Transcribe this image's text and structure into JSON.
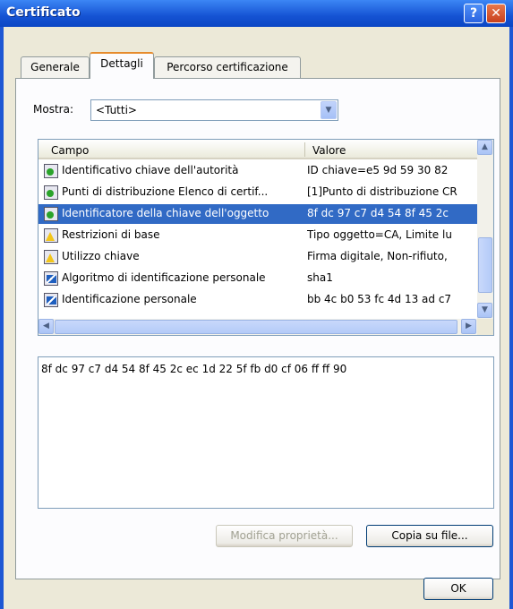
{
  "window": {
    "title": "Certificato",
    "help_label": "?",
    "close_label": "✕"
  },
  "tabs": [
    {
      "label": "Generale"
    },
    {
      "label": "Dettagli"
    },
    {
      "label": "Percorso certificazione"
    }
  ],
  "mostra": {
    "label": "Mostra:",
    "value": "<Tutti>"
  },
  "list": {
    "columns": {
      "campo": "Campo",
      "valore": "Valore"
    },
    "rows": [
      {
        "icon": "green-arrow-cert-icon",
        "campo": "Identificativo chiave dell'autorità",
        "valore": "ID chiave=e5 9d 59 30 82"
      },
      {
        "icon": "green-arrow-cert-icon",
        "campo": "Punti di distribuzione Elenco di certif...",
        "valore": "[1]Punto di distribuzione CR"
      },
      {
        "icon": "green-arrow-cert-icon",
        "campo": "Identificatore della chiave dell'oggetto",
        "valore": "8f dc 97 c7 d4 54 8f 45 2c"
      },
      {
        "icon": "warning-cert-icon",
        "campo": "Restrizioni di base",
        "valore": "Tipo oggetto=CA, Limite lu"
      },
      {
        "icon": "warning-cert-icon",
        "campo": "Utilizzo chiave",
        "valore": "Firma digitale, Non-rifiuto,"
      },
      {
        "icon": "document-cert-icon",
        "campo": "Algoritmo di identificazione personale",
        "valore": "sha1"
      },
      {
        "icon": "document-cert-icon",
        "campo": "Identificazione personale",
        "valore": "bb 4c b0 53 fc 4d 13 ad c7"
      }
    ],
    "selected_index": 2
  },
  "detail": {
    "text": "8f dc 97 c7 d4 54 8f 45 2c ec 1d 22 5f fb d0 cf 06 ff ff 90"
  },
  "buttons": {
    "modifica": "Modifica proprietà...",
    "copia": "Copia su file...",
    "ok": "OK"
  },
  "colors": {
    "title_bar": "#0b46c4",
    "selection": "#316ac5",
    "active_tab_accent": "#e68b2c"
  }
}
